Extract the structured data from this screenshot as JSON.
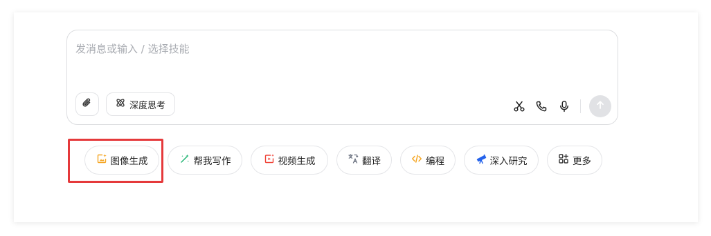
{
  "composer": {
    "placeholder": "发消息或输入 / 选择技能",
    "deep_think_label": "深度思考"
  },
  "icons": {
    "attach": "paperclip-icon",
    "deep_think": "atom-icon",
    "scissors": "scissors-icon",
    "phone": "phone-icon",
    "microphone": "microphone-icon",
    "send": "arrow-up-icon"
  },
  "skills": [
    {
      "label": "图像生成",
      "icon": "image-gen-icon",
      "color": "#f5a623",
      "highlighted": true
    },
    {
      "label": "帮我写作",
      "icon": "pen-sparkle-icon",
      "color": "#22b573"
    },
    {
      "label": "视频生成",
      "icon": "video-gen-icon",
      "color": "#f04438"
    },
    {
      "label": "翻译",
      "icon": "translate-icon",
      "color": "#6b7280"
    },
    {
      "label": "编程",
      "icon": "code-icon",
      "color": "#f5a623"
    },
    {
      "label": "深入研究",
      "icon": "telescope-icon",
      "color": "#2563eb"
    },
    {
      "label": "更多",
      "icon": "grid-plus-icon",
      "color": "#333333"
    }
  ],
  "colors": {
    "highlight_box": "#e5393b",
    "send_disabled": "#e1e2e5"
  }
}
